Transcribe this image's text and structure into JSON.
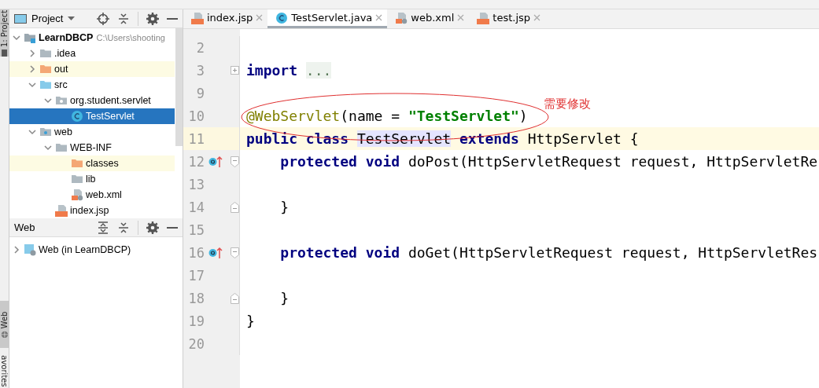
{
  "tool_strip": [
    {
      "label": "1: Project",
      "kind": "project",
      "selected": true
    },
    {
      "label": "Web",
      "kind": "web",
      "selected": true
    },
    {
      "label": "avorites",
      "kind": "favorites",
      "selected": false
    }
  ],
  "project_panel": {
    "title": "Project",
    "tree": [
      {
        "label": "LearnDBCP",
        "hint": "C:\\Users\\shooting",
        "kind": "module",
        "expanded": true,
        "selected": false,
        "highlighted": false,
        "children": [
          {
            "label": ".idea",
            "kind": "folder",
            "expanded": false,
            "selected": false,
            "highlighted": false
          },
          {
            "label": "out",
            "kind": "folder-excluded",
            "expanded": false,
            "selected": false,
            "highlighted": true
          },
          {
            "label": "src",
            "kind": "folder-source",
            "expanded": true,
            "selected": false,
            "highlighted": false,
            "children": [
              {
                "label": "org.student.servlet",
                "kind": "package",
                "expanded": true,
                "selected": false,
                "highlighted": false,
                "children": [
                  {
                    "label": "TestServlet",
                    "kind": "class",
                    "selected": true,
                    "highlighted": false
                  }
                ]
              }
            ]
          },
          {
            "label": "web",
            "kind": "folder-web",
            "expanded": true,
            "selected": false,
            "highlighted": false,
            "children": [
              {
                "label": "WEB-INF",
                "kind": "folder",
                "expanded": true,
                "selected": false,
                "highlighted": false,
                "children": [
                  {
                    "label": "classes",
                    "kind": "folder-excluded",
                    "selected": false,
                    "highlighted": true
                  },
                  {
                    "label": "lib",
                    "kind": "folder",
                    "selected": false,
                    "highlighted": false
                  },
                  {
                    "label": "web.xml",
                    "kind": "xml",
                    "selected": false,
                    "highlighted": false
                  }
                ]
              },
              {
                "label": "index.jsp",
                "kind": "jsp",
                "selected": false,
                "highlighted": false
              }
            ]
          }
        ]
      }
    ]
  },
  "web_panel": {
    "title": "Web",
    "tree": [
      {
        "label": "Web (in LearnDBCP)",
        "kind": "web-facet",
        "expanded": false,
        "selected": false
      }
    ]
  },
  "editor_tabs": [
    {
      "label": "index.jsp",
      "kind": "jsp",
      "selected": false
    },
    {
      "label": "TestServlet.java",
      "kind": "class",
      "selected": true
    },
    {
      "label": "web.xml",
      "kind": "xml",
      "selected": false
    },
    {
      "label": "test.jsp",
      "kind": "jsp",
      "selected": false
    }
  ],
  "code_lines": [
    {
      "number": "2",
      "current": false,
      "override_marker": false,
      "fold_start": false,
      "fold_end": false,
      "folded": false
    },
    {
      "number": "3",
      "current": false,
      "override_marker": false,
      "fold_start": false,
      "fold_end": false,
      "folded": true,
      "tokens": [
        {
          "kind": "keyword",
          "text": "import "
        },
        {
          "kind": "folded",
          "text": "..."
        }
      ]
    },
    {
      "number": "9",
      "current": false,
      "override_marker": false,
      "fold_start": false,
      "fold_end": false,
      "folded": false
    },
    {
      "number": "10",
      "current": false,
      "override_marker": false,
      "fold_start": false,
      "fold_end": false,
      "folded": false,
      "tokens": [
        {
          "kind": "annotation",
          "text": "@WebServlet"
        },
        {
          "kind": "plain",
          "text": "(name = "
        },
        {
          "kind": "string",
          "text": "\"TestServlet\""
        },
        {
          "kind": "plain",
          "text": ")"
        }
      ]
    },
    {
      "number": "11",
      "current": true,
      "override_marker": false,
      "fold_start": false,
      "fold_end": false,
      "folded": false,
      "tokens": [
        {
          "kind": "keyword",
          "text": "public class "
        },
        {
          "kind": "usage",
          "text": "TestServlet"
        },
        {
          "kind": "keyword",
          "text": " extends"
        },
        {
          "kind": "plain",
          "text": " HttpServlet {"
        }
      ]
    },
    {
      "number": "12",
      "current": false,
      "override_marker": true,
      "fold_start": true,
      "fold_end": false,
      "folded": false,
      "tokens": [
        {
          "kind": "keyword",
          "text": "    protected void"
        },
        {
          "kind": "plain",
          "text": " doPost(HttpServletRequest request, HttpServletRe"
        }
      ]
    },
    {
      "number": "13",
      "current": false,
      "override_marker": false,
      "fold_start": false,
      "fold_end": false,
      "folded": false
    },
    {
      "number": "14",
      "current": false,
      "override_marker": false,
      "fold_start": false,
      "fold_end": true,
      "folded": false,
      "tokens": [
        {
          "kind": "plain",
          "text": "    }"
        }
      ]
    },
    {
      "number": "15",
      "current": false,
      "override_marker": false,
      "fold_start": false,
      "fold_end": false,
      "folded": false
    },
    {
      "number": "16",
      "current": false,
      "override_marker": true,
      "fold_start": true,
      "fold_end": false,
      "folded": false,
      "tokens": [
        {
          "kind": "keyword",
          "text": "    protected void"
        },
        {
          "kind": "plain",
          "text": " doGet(HttpServletRequest request, HttpServletRes"
        }
      ]
    },
    {
      "number": "17",
      "current": false,
      "override_marker": false,
      "fold_start": false,
      "fold_end": false,
      "folded": false
    },
    {
      "number": "18",
      "current": false,
      "override_marker": false,
      "fold_start": false,
      "fold_end": true,
      "folded": false,
      "tokens": [
        {
          "kind": "plain",
          "text": "    }"
        }
      ]
    },
    {
      "number": "19",
      "current": false,
      "override_marker": false,
      "fold_start": false,
      "fold_end": false,
      "folded": false,
      "tokens": [
        {
          "kind": "plain",
          "text": "}"
        }
      ]
    },
    {
      "number": "20",
      "current": false,
      "override_marker": false,
      "fold_start": false,
      "fold_end": false,
      "folded": false
    }
  ],
  "annotation": {
    "note": "需要修改"
  }
}
